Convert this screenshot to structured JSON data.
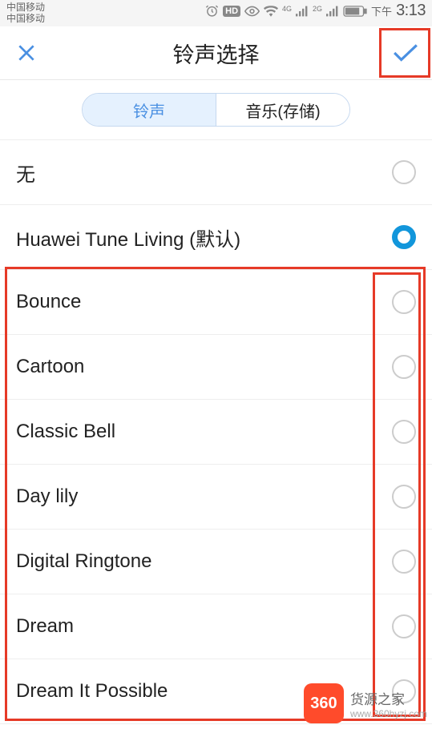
{
  "status": {
    "carrier1": "中国移动",
    "carrier2": "中国移动",
    "hd": "HD",
    "net1": "4G",
    "net2": "2G",
    "period": "下午",
    "time": "3:13"
  },
  "header": {
    "title": "铃声选择"
  },
  "tabs": {
    "ringtone": "铃声",
    "music": "音乐(存储)"
  },
  "items": [
    {
      "label": "无",
      "sel": false
    },
    {
      "label": "Huawei Tune Living (默认)",
      "sel": true
    },
    {
      "label": "Bounce",
      "sel": false
    },
    {
      "label": "Cartoon",
      "sel": false
    },
    {
      "label": "Classic Bell",
      "sel": false
    },
    {
      "label": "Day lily",
      "sel": false
    },
    {
      "label": "Digital Ringtone",
      "sel": false
    },
    {
      "label": "Dream",
      "sel": false
    },
    {
      "label": "Dream It Possible",
      "sel": false
    }
  ],
  "wm": {
    "badge": "360",
    "line1": "货源之家",
    "line2": "www.360hyzj.com"
  }
}
